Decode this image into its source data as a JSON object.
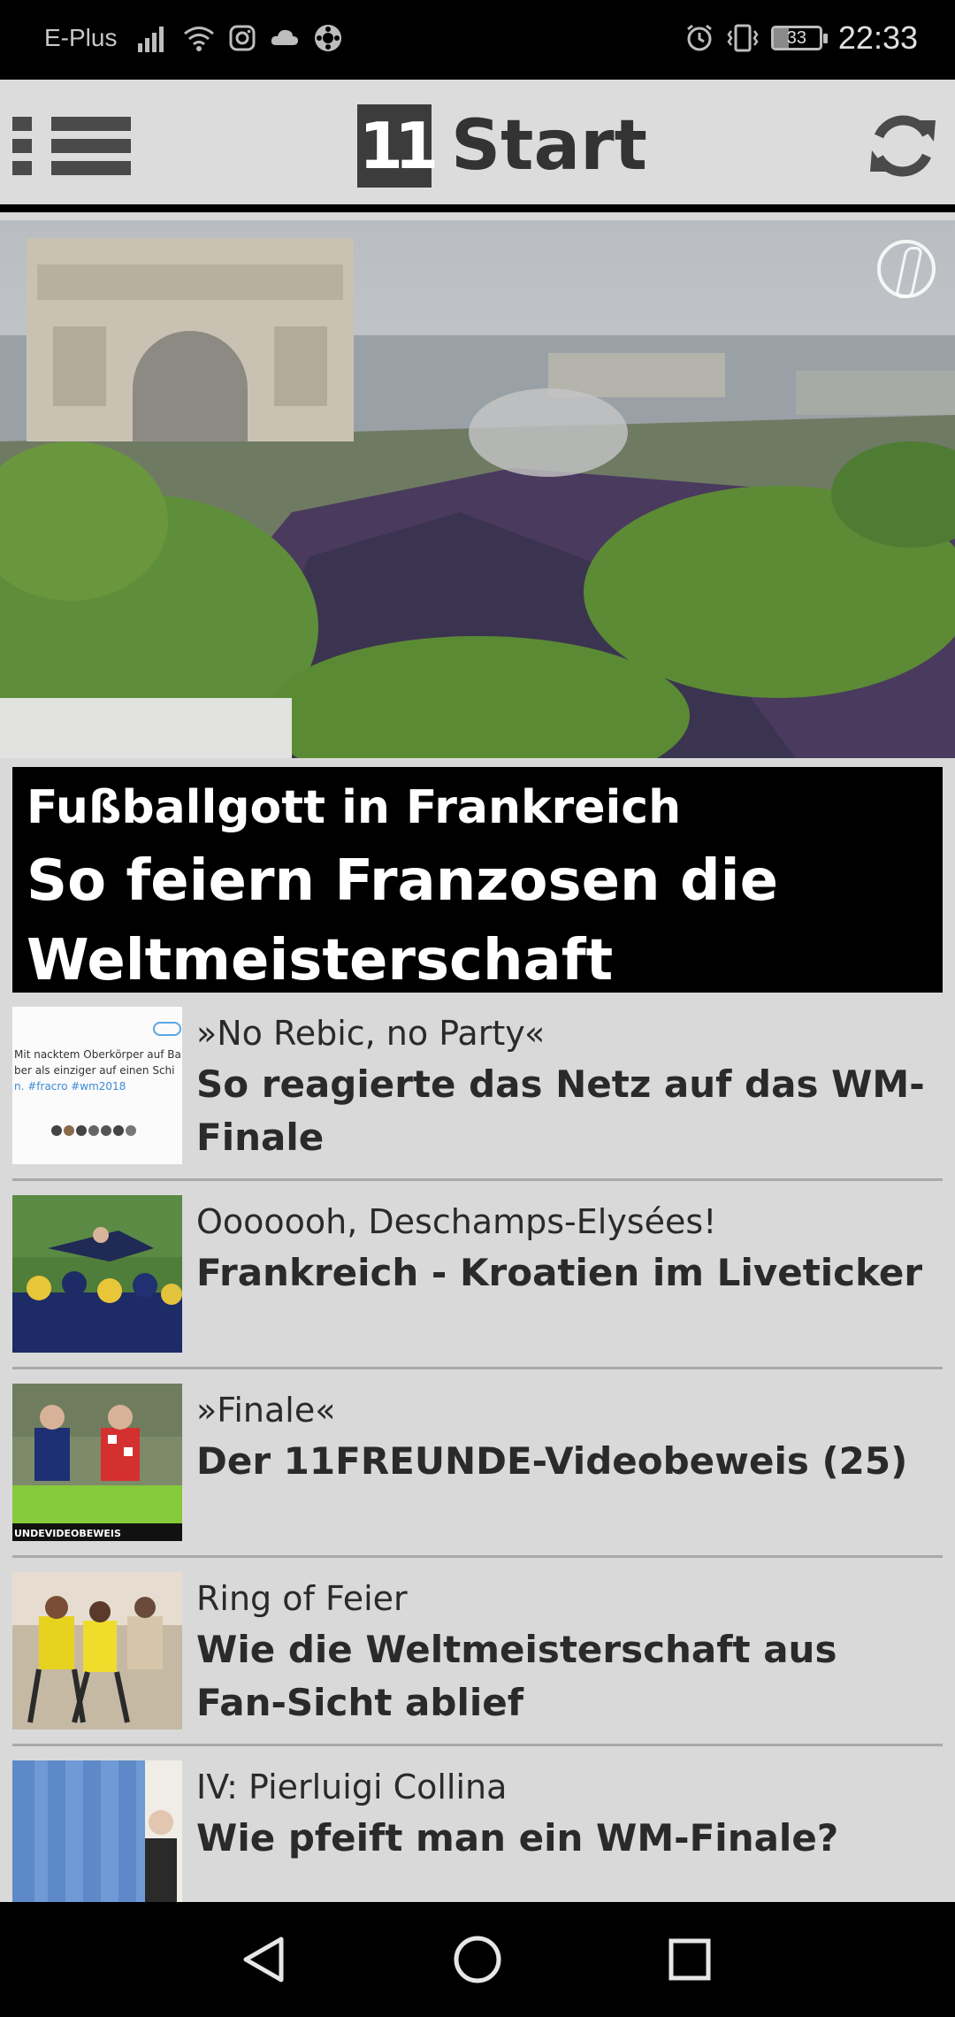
{
  "status_bar": {
    "carrier": "E-Plus",
    "battery": "33",
    "battery_level": 0.33,
    "time": "22:33",
    "icons": [
      "signal-icon",
      "wifi-icon",
      "instagram-icon",
      "cloud-icon",
      "app-icon",
      "alarm-icon",
      "vibrate-icon",
      "battery-icon"
    ]
  },
  "header": {
    "logo_text": "11",
    "title": "Start"
  },
  "hero": {
    "kicker": "Fußballgott in Frankreich",
    "headline": "So feiern Franzosen die Weltmeisterschaft"
  },
  "articles": [
    {
      "kicker": "»No Rebic, no Party«",
      "title": "So reagierte das Netz auf das WM-Finale"
    },
    {
      "kicker": "Ooooooh, Deschamps-Elysées!",
      "title": "Frankreich - Kroatien im Liveticker"
    },
    {
      "kicker": "»Finale«",
      "title": "Der 11FREUNDE-Videobeweis (25)"
    },
    {
      "kicker": "Ring of Feier",
      "title": "Wie die Weltmeisterschaft aus Fan-Sicht ablief"
    },
    {
      "kicker": "IV: Pierluigi Collina",
      "title": "Wie pfeift man ein WM-Finale?"
    }
  ],
  "thumb_text": {
    "tweet_lines": [
      "Mit nacktem Oberkörper auf Ba",
      "ber als einziger auf einen Schi",
      "n. #fracro #wm2018"
    ],
    "video_banner": "UNDEVIDEOBEWEIS"
  },
  "nav": {
    "icons": [
      "back-icon",
      "home-icon",
      "recents-icon"
    ]
  }
}
